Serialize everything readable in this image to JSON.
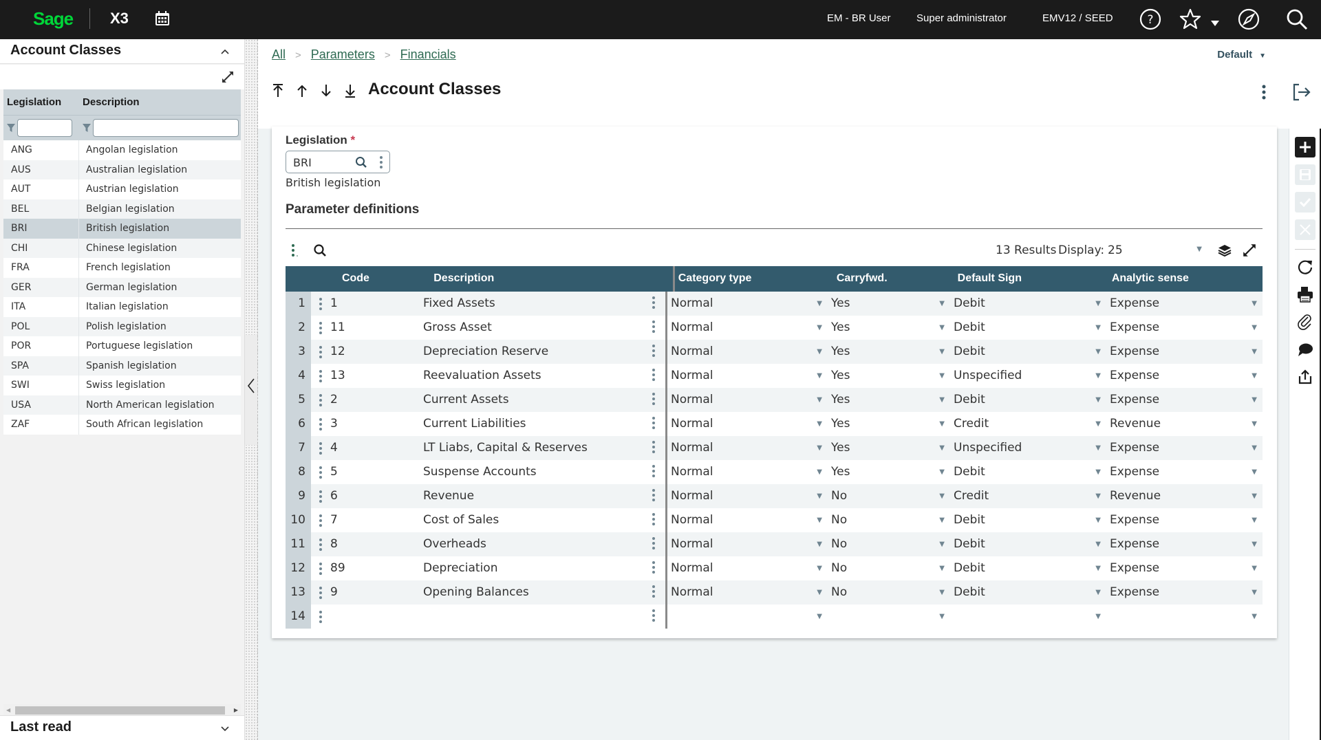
{
  "topbar": {
    "logo": "Sage",
    "product": "X3",
    "user": "EM - BR User",
    "role": "Super administrator",
    "folder": "EMV12 / SEED"
  },
  "left_panel": {
    "title": "Account Classes",
    "columns": [
      "Legislation",
      "Description"
    ],
    "filter_values": [
      "",
      ""
    ],
    "selected": "BRI",
    "rows": [
      {
        "code": "ANG",
        "desc": "Angolan legislation"
      },
      {
        "code": "AUS",
        "desc": "Australian legislation"
      },
      {
        "code": "AUT",
        "desc": "Austrian legislation"
      },
      {
        "code": "BEL",
        "desc": "Belgian legislation"
      },
      {
        "code": "BRI",
        "desc": "British legislation"
      },
      {
        "code": "CHI",
        "desc": "Chinese legislation"
      },
      {
        "code": "FRA",
        "desc": "French legislation"
      },
      {
        "code": "GER",
        "desc": "German legislation"
      },
      {
        "code": "ITA",
        "desc": "Italian legislation"
      },
      {
        "code": "POL",
        "desc": "Polish legislation"
      },
      {
        "code": "POR",
        "desc": "Portuguese legislation"
      },
      {
        "code": "SPA",
        "desc": "Spanish legislation"
      },
      {
        "code": "SWI",
        "desc": "Swiss legislation"
      },
      {
        "code": "USA",
        "desc": "North American legislation"
      },
      {
        "code": "ZAF",
        "desc": "South African legislation"
      }
    ],
    "last_read": "Last read"
  },
  "main": {
    "breadcrumbs": [
      "All",
      "Parameters",
      "Financials"
    ],
    "view_selector": "Default",
    "title": "Account Classes",
    "legislation": {
      "label": "Legislation",
      "required_mark": "*",
      "value": "BRI",
      "description": "British legislation"
    },
    "section_title": "Parameter definitions",
    "grid": {
      "results": "13 Results",
      "display_label": "Display:",
      "display_value": "25",
      "columns": [
        "Code",
        "Description",
        "Category type",
        "Carryfwd.",
        "Default Sign",
        "Analytic sense"
      ],
      "rows": [
        {
          "n": "1",
          "code": "1",
          "desc": "Fixed Assets",
          "cat": "Normal",
          "cf": "Yes",
          "sign": "Debit",
          "an": "Expense"
        },
        {
          "n": "2",
          "code": "11",
          "desc": "Gross Asset",
          "cat": "Normal",
          "cf": "Yes",
          "sign": "Debit",
          "an": "Expense"
        },
        {
          "n": "3",
          "code": "12",
          "desc": "Depreciation Reserve",
          "cat": "Normal",
          "cf": "Yes",
          "sign": "Debit",
          "an": "Expense"
        },
        {
          "n": "4",
          "code": "13",
          "desc": "Reevaluation Assets",
          "cat": "Normal",
          "cf": "Yes",
          "sign": "Unspecified",
          "an": "Expense"
        },
        {
          "n": "5",
          "code": "2",
          "desc": "Current  Assets",
          "cat": "Normal",
          "cf": "Yes",
          "sign": "Debit",
          "an": "Expense"
        },
        {
          "n": "6",
          "code": "3",
          "desc": "Current Liabilities",
          "cat": "Normal",
          "cf": "Yes",
          "sign": "Credit",
          "an": "Revenue"
        },
        {
          "n": "7",
          "code": "4",
          "desc": "LT Liabs, Capital & Reserves",
          "cat": "Normal",
          "cf": "Yes",
          "sign": "Unspecified",
          "an": "Expense"
        },
        {
          "n": "8",
          "code": "5",
          "desc": "Suspense Accounts",
          "cat": "Normal",
          "cf": "Yes",
          "sign": "Debit",
          "an": "Expense"
        },
        {
          "n": "9",
          "code": "6",
          "desc": "Revenue",
          "cat": "Normal",
          "cf": "No",
          "sign": "Credit",
          "an": "Revenue"
        },
        {
          "n": "10",
          "code": "7",
          "desc": "Cost of Sales",
          "cat": "Normal",
          "cf": "No",
          "sign": "Debit",
          "an": "Expense"
        },
        {
          "n": "11",
          "code": "8",
          "desc": "Overheads",
          "cat": "Normal",
          "cf": "No",
          "sign": "Debit",
          "an": "Expense"
        },
        {
          "n": "12",
          "code": "89",
          "desc": "Depreciation",
          "cat": "Normal",
          "cf": "No",
          "sign": "Debit",
          "an": "Expense"
        },
        {
          "n": "13",
          "code": "9",
          "desc": "Opening Balances",
          "cat": "Normal",
          "cf": "No",
          "sign": "Debit",
          "an": "Expense"
        },
        {
          "n": "14",
          "code": "",
          "desc": "",
          "cat": "",
          "cf": "",
          "sign": "",
          "an": ""
        }
      ]
    }
  },
  "right_toolbar": [
    {
      "icon": "plus-icon",
      "name": "create-button",
      "enabled": true
    },
    {
      "icon": "save-icon",
      "name": "save-button",
      "enabled": false
    },
    {
      "icon": "check-icon",
      "name": "validate-button",
      "enabled": false
    },
    {
      "icon": "close-icon",
      "name": "cancel-button",
      "enabled": false
    },
    {
      "icon": "refresh-icon",
      "name": "refresh-button",
      "enabled": true
    },
    {
      "icon": "print-icon",
      "name": "print-button",
      "enabled": true
    },
    {
      "icon": "paperclip-icon",
      "name": "attachments-button",
      "enabled": true
    },
    {
      "icon": "comment-icon",
      "name": "comments-button",
      "enabled": true
    },
    {
      "icon": "export-icon",
      "name": "export-button",
      "enabled": true
    }
  ],
  "colors": {
    "brand_green": "#00d639",
    "header_bg": "#1b1b1b",
    "grid_header": "#335b6d",
    "link": "#2e6a52",
    "required": "#c7384f"
  }
}
